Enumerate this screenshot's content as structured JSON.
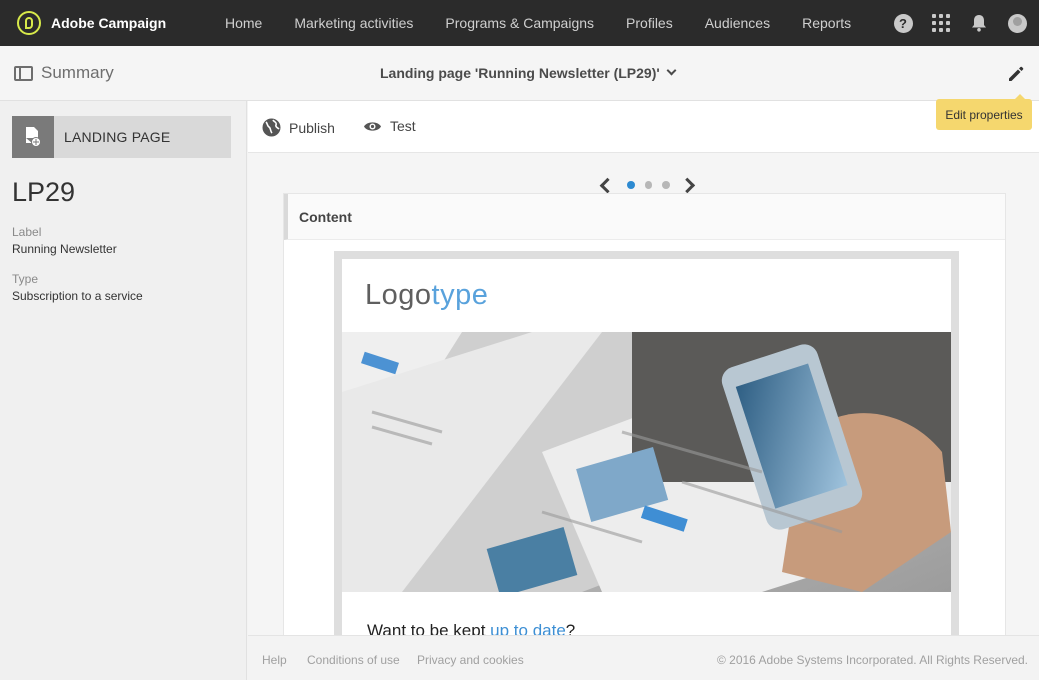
{
  "app": {
    "brand": "Adobe Campaign",
    "nav": [
      "Home",
      "Marketing activities",
      "Programs & Campaigns",
      "Profiles",
      "Audiences",
      "Reports"
    ],
    "icons": [
      "help-icon",
      "apps-icon",
      "bell-icon",
      "avatar-icon"
    ]
  },
  "subheader": {
    "summary_label": "Summary",
    "title": "Landing page 'Running Newsletter (LP29)'",
    "edit_tooltip": "Edit properties"
  },
  "left_panel": {
    "type_card": "LANDING PAGE",
    "id": "LP29",
    "fields": [
      {
        "label": "Label",
        "value": "Running Newsletter"
      },
      {
        "label": "Type",
        "value": "Subscription to a service"
      }
    ]
  },
  "toolbar": {
    "publish": "Publish",
    "test": "Test"
  },
  "carousel": {
    "pages": 3,
    "active": 1
  },
  "content": {
    "header": "Content",
    "logo_part1": "Logo",
    "logo_part2": "type",
    "headline_start": "Want to be kept ",
    "headline_link": "up to date",
    "headline_end": "?"
  },
  "footer": {
    "links": [
      "Help",
      "Conditions of use",
      "Privacy and cookies"
    ],
    "copyright": "© 2016 Adobe Systems Incorporated. All Rights Reserved."
  },
  "colors": {
    "topbar": "#2b2b2b",
    "brand_accent": "#d7e94a",
    "link_blue": "#3d8fd4",
    "tooltip": "#f5d76e",
    "active_dot": "#2d8ad1"
  }
}
